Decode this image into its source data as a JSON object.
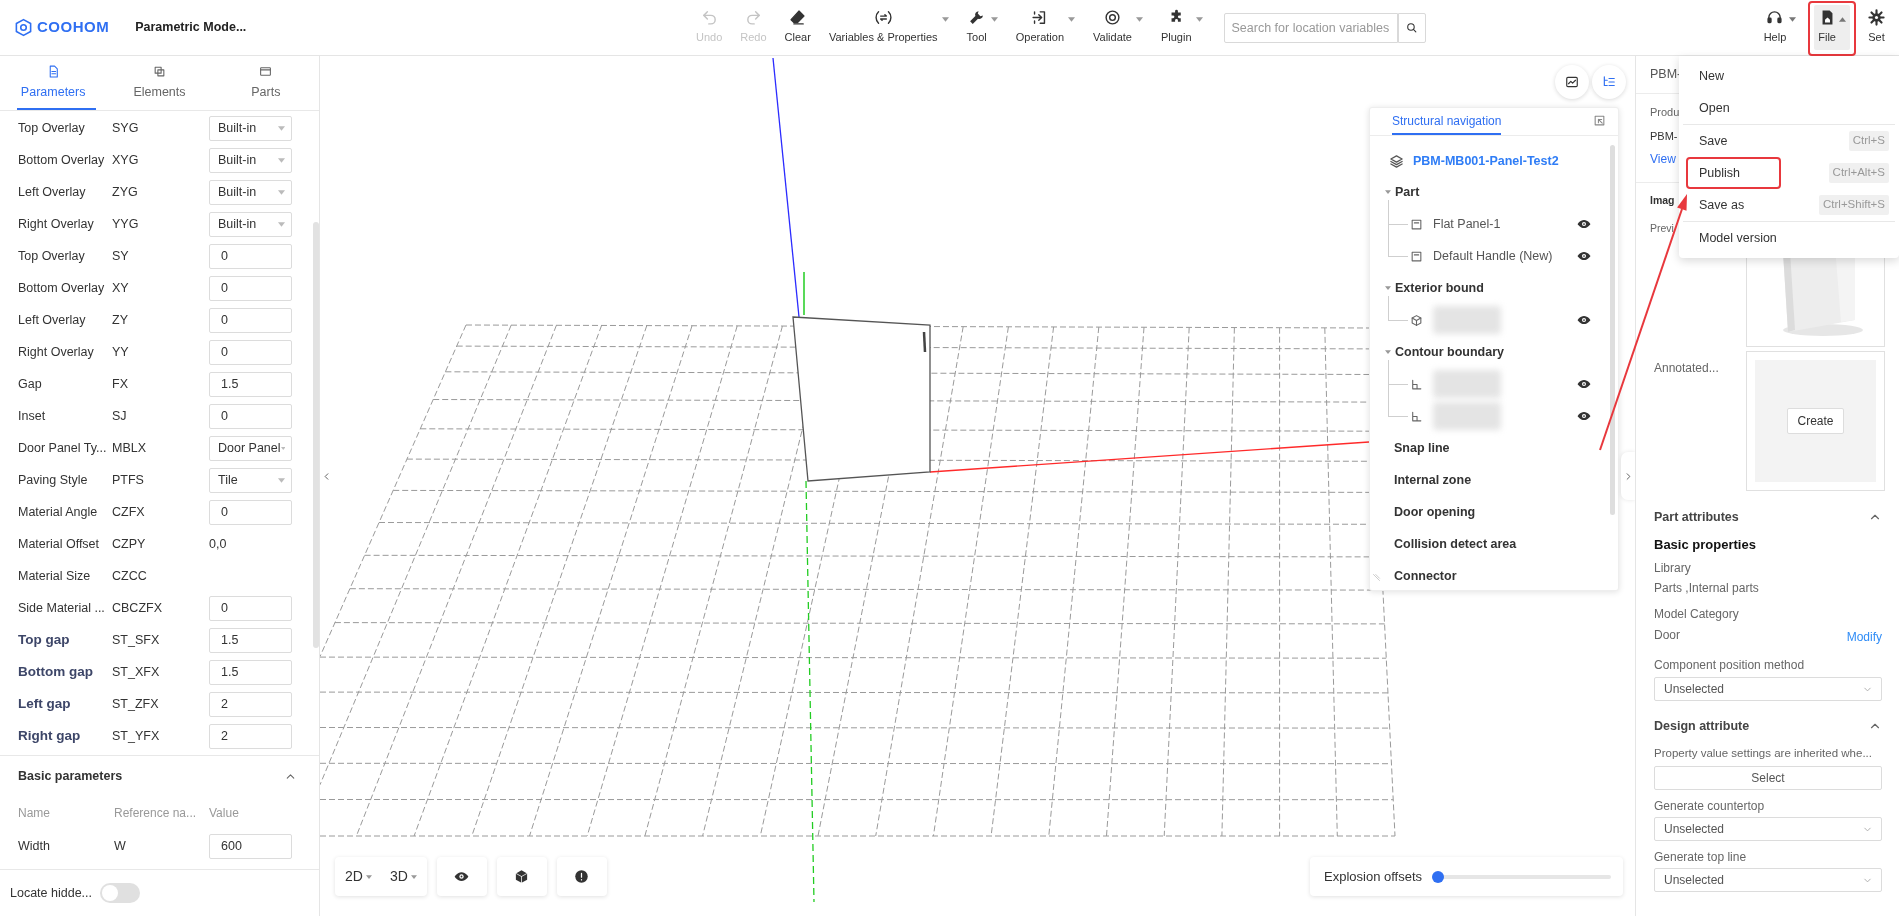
{
  "header": {
    "logo": "COOHOM",
    "title": "Parametric Mode..."
  },
  "toolbar": [
    {
      "label": "Undo",
      "disabled": true,
      "dropdown": false
    },
    {
      "label": "Redo",
      "disabled": true,
      "dropdown": false
    },
    {
      "label": "Clear",
      "disabled": false,
      "dropdown": false
    },
    {
      "label": "Variables & Properties",
      "disabled": false,
      "dropdown": true
    },
    {
      "label": "Tool",
      "disabled": false,
      "dropdown": true
    },
    {
      "label": "Operation",
      "disabled": false,
      "dropdown": true
    },
    {
      "label": "Validate",
      "disabled": false,
      "dropdown": true
    },
    {
      "label": "Plugin",
      "disabled": false,
      "dropdown": true
    }
  ],
  "search": {
    "placeholder": "Search for location variables"
  },
  "right_tools": [
    {
      "label": "Help",
      "dropdown": true,
      "open": false,
      "highlighted": false
    },
    {
      "label": "File",
      "dropdown": true,
      "open": true,
      "highlighted": true
    },
    {
      "label": "Set",
      "dropdown": false,
      "open": false,
      "highlighted": false
    }
  ],
  "left_panel": {
    "tabs": [
      {
        "label": "Parameters",
        "selected": true
      },
      {
        "label": "Elements",
        "selected": false
      },
      {
        "label": "Parts",
        "selected": false
      }
    ],
    "parameters": [
      {
        "name": "Top Overlay",
        "code": "SYG",
        "kind": "select",
        "value": "Built-in",
        "emphasis": false
      },
      {
        "name": "Bottom Overlay",
        "code": "XYG",
        "kind": "select",
        "value": "Built-in",
        "emphasis": false
      },
      {
        "name": "Left Overlay",
        "code": "ZYG",
        "kind": "select",
        "value": "Built-in",
        "emphasis": false
      },
      {
        "name": "Right Overlay",
        "code": "YYG",
        "kind": "select",
        "value": "Built-in",
        "emphasis": false
      },
      {
        "name": "Top Overlay",
        "code": "SY",
        "kind": "input",
        "value": "0",
        "emphasis": false
      },
      {
        "name": "Bottom Overlay",
        "code": "XY",
        "kind": "input",
        "value": "0",
        "emphasis": false
      },
      {
        "name": "Left Overlay",
        "code": "ZY",
        "kind": "input",
        "value": "0",
        "emphasis": false
      },
      {
        "name": "Right Overlay",
        "code": "YY",
        "kind": "input",
        "value": "0",
        "emphasis": false
      },
      {
        "name": "Gap",
        "code": "FX",
        "kind": "input",
        "value": "1.5",
        "emphasis": false
      },
      {
        "name": "Inset",
        "code": "SJ",
        "kind": "input",
        "value": "0",
        "emphasis": false
      },
      {
        "name": "Door Panel Ty...",
        "code": "MBLX",
        "kind": "select",
        "value": "Door Panel",
        "emphasis": false
      },
      {
        "name": "Paving Style",
        "code": "PTFS",
        "kind": "select",
        "value": "Tile",
        "emphasis": false
      },
      {
        "name": "Material Angle",
        "code": "CZFX",
        "kind": "input",
        "value": "0",
        "emphasis": false
      },
      {
        "name": "Material Offset",
        "code": "CZPY",
        "kind": "text",
        "value": "0,0",
        "emphasis": false
      },
      {
        "name": "Material Size",
        "code": "CZCC",
        "kind": "empty",
        "emphasis": false
      },
      {
        "name": "Side Material ...",
        "code": "CBCZFX",
        "kind": "input",
        "value": "0",
        "emphasis": false
      },
      {
        "name": "Top gap",
        "code": "ST_SFX",
        "kind": "input",
        "value": "1.5",
        "emphasis": true
      },
      {
        "name": "Bottom gap",
        "code": "ST_XFX",
        "kind": "input",
        "value": "1.5",
        "emphasis": true
      },
      {
        "name": "Left gap",
        "code": "ST_ZFX",
        "kind": "input",
        "value": "2",
        "emphasis": true
      },
      {
        "name": "Right gap",
        "code": "ST_YFX",
        "kind": "input",
        "value": "2",
        "emphasis": true
      }
    ],
    "basic_parameters": {
      "title": "Basic parameters",
      "expanded": true,
      "columns": [
        "Name",
        "Reference na...",
        "Value"
      ],
      "rows": [
        {
          "name": "Width",
          "code": "W",
          "value": "600"
        }
      ]
    },
    "locate_hidden": {
      "label": "Locate hidde...",
      "on": false
    }
  },
  "viewport": {
    "view_modes": [
      {
        "label": "2D"
      },
      {
        "label": "3D"
      }
    ],
    "explosion": {
      "label": "Explosion offsets",
      "level": 0.02
    }
  },
  "structure_nav": {
    "tab": "Structural navigation",
    "root": "PBM-MB001-Panel-Test2",
    "groups": [
      {
        "label": "Part",
        "expanded": true,
        "children": [
          {
            "kind": "panel",
            "label": "Flat Panel-1",
            "visible": true
          },
          {
            "kind": "panel",
            "label": "Default Handle (New)",
            "visible": true
          }
        ]
      },
      {
        "label": "Exterior bound",
        "expanded": true,
        "children": [
          {
            "kind": "solid",
            "visible": true
          }
        ]
      },
      {
        "label": "Contour boundary",
        "expanded": true,
        "children": [
          {
            "kind": "contour",
            "visible": true
          },
          {
            "kind": "contour",
            "visible": true
          }
        ]
      },
      {
        "label": "Snap line"
      },
      {
        "label": "Internal zone"
      },
      {
        "label": "Door opening"
      },
      {
        "label": "Collision detect area"
      },
      {
        "label": "Connector"
      }
    ]
  },
  "file_menu": {
    "items": [
      {
        "label": "New",
        "divider_before": false,
        "highlighted": false
      },
      {
        "label": "Open",
        "divider_before": false,
        "highlighted": false
      },
      {
        "label": "Save",
        "shortcut": "Ctrl+S",
        "divider_before": true,
        "highlighted": false
      },
      {
        "label": "Publish",
        "shortcut": "Ctrl+Alt+S",
        "divider_before": false,
        "highlighted": true
      },
      {
        "label": "Save as",
        "shortcut": "Ctrl+Shift+S",
        "divider_before": false,
        "highlighted": false
      },
      {
        "label": "Model version",
        "divider_before": true,
        "highlighted": false
      }
    ]
  },
  "right_panel": {
    "header": "PBM-",
    "product_label": "Produ",
    "product_value": "PBM-",
    "view_link": "View",
    "image_section": "Imag",
    "preview_label": "Previ",
    "annotated_label": "Annotated...",
    "create_button": "Create",
    "part_attributes": {
      "title": "Part attributes",
      "expanded": true,
      "subtitle": "Basic properties",
      "library_label": "Library",
      "library_value": "Parts ,Internal parts",
      "category_label": "Model Category",
      "category_value": "Door",
      "modify_link": "Modify",
      "position_label": "Component position method",
      "position_value": "Unselected"
    },
    "design_attribute": {
      "title": "Design attribute",
      "expanded": true,
      "inherit_label": "Property value settings are inherited whe...",
      "select_button": "Select",
      "fields": [
        {
          "label": "Generate countertop",
          "value": "Unselected"
        },
        {
          "label": "Generate top line",
          "value": "Unselected"
        }
      ]
    }
  }
}
